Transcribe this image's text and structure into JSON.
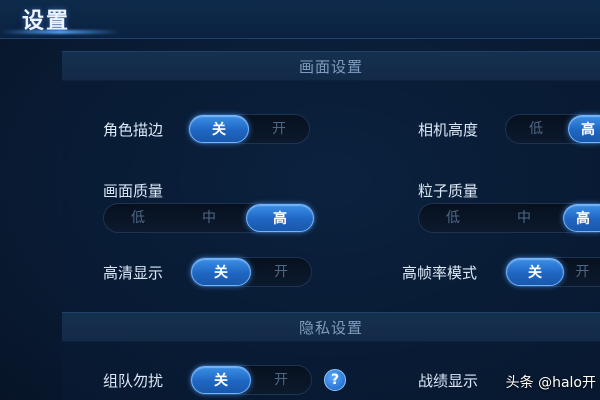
{
  "header": {
    "title": "设置"
  },
  "sections": {
    "display": "画面设置",
    "privacy": "隐私设置"
  },
  "settings": {
    "character_outline": {
      "label": "角色描边",
      "options": [
        "关",
        "开"
      ],
      "selected": "关"
    },
    "camera_height": {
      "label": "相机高度",
      "options": [
        "低",
        "高"
      ],
      "selected": "高"
    },
    "graphics_quality": {
      "label": "画面质量",
      "options": [
        "低",
        "中",
        "高"
      ],
      "selected": "高"
    },
    "particle_quality": {
      "label": "粒子质量",
      "options": [
        "低",
        "中",
        "高"
      ],
      "selected": "高"
    },
    "hd_display": {
      "label": "高清显示",
      "options": [
        "关",
        "开"
      ],
      "selected": "关"
    },
    "high_fps_mode": {
      "label": "高帧率模式",
      "options": [
        "关",
        "开"
      ],
      "selected": "关"
    },
    "team_no_disturb": {
      "label": "组队勿扰",
      "options": [
        "关",
        "开"
      ],
      "selected": "关"
    },
    "record_display": {
      "label": "战绩显示"
    }
  },
  "help": {
    "glyph": "?"
  },
  "watermark": "头条 @halo开",
  "colors": {
    "accent": "#2a7ad8",
    "background": "#0a1e38"
  }
}
